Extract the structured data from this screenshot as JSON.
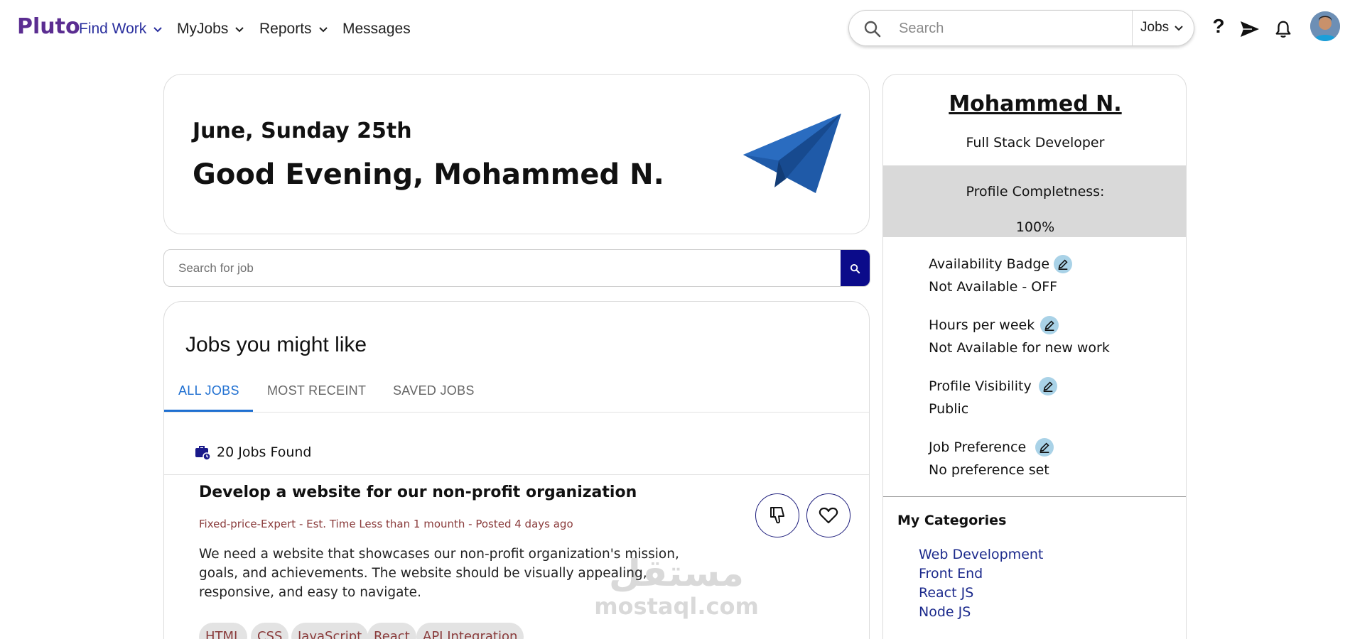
{
  "brand": {
    "name": "Pluto",
    "color": "#5b2d91"
  },
  "nav": {
    "find_work": "Find Work",
    "my_jobs": "MyJobs",
    "reports": "Reports",
    "messages": "Messages"
  },
  "search": {
    "placeholder": "Search",
    "scope": "Jobs"
  },
  "top_icons": {
    "help": "?",
    "send": "send-icon",
    "bell": "bell-icon",
    "avatar": "avatar"
  },
  "greeting": {
    "date": "June, Sunday 25th",
    "message": "Good Evening, Mohammed N."
  },
  "job_search": {
    "placeholder": "Search for job"
  },
  "jobs": {
    "title": "Jobs you might like",
    "tabs": [
      "ALL JOBS",
      "MOST RECEINT",
      "SAVED JOBS"
    ],
    "active_tab": "ALL JOBS",
    "found": "20 Jobs Found",
    "items": [
      {
        "title": "Develop a website for our non-profit organization",
        "meta": "Fixed-price-Expert - Est. Time Less than 1 mounth - Posted 4 days ago",
        "description": "We need a website that showcases our non-profit organization's mission, goals, and achievements. The website should be visually appealing, responsive, and easy to navigate.",
        "skills": [
          "HTML",
          "CSS",
          "JavaScript",
          "React",
          "API Integration"
        ]
      }
    ]
  },
  "profile": {
    "name": "Mohammed N.",
    "role": "Full Stack Developer",
    "completeness_label": "Profile Completness:",
    "completeness_value": "100%",
    "fields": [
      {
        "label": "Availability Badge",
        "value": "Not Available - OFF"
      },
      {
        "label": "Hours per week",
        "value": "Not Available for new work"
      },
      {
        "label": "Profile Visibility",
        "value": "Public"
      },
      {
        "label": "Job Preference",
        "value": "No preference set"
      }
    ],
    "categories_title": "My Categories",
    "categories": [
      "Web Development",
      "Front End",
      "React JS",
      "Node JS"
    ]
  },
  "watermark": {
    "arabic": "مستقل",
    "latin": "mostaql.com"
  },
  "colors": {
    "accent_blue": "#1e6fd1",
    "navy": "#0b0b8a",
    "meta_red": "#8a3b3b",
    "completeness_bg": "#d9d9d9",
    "edit_badge": "#a9d2e7",
    "plane": "#1f5aa8"
  }
}
